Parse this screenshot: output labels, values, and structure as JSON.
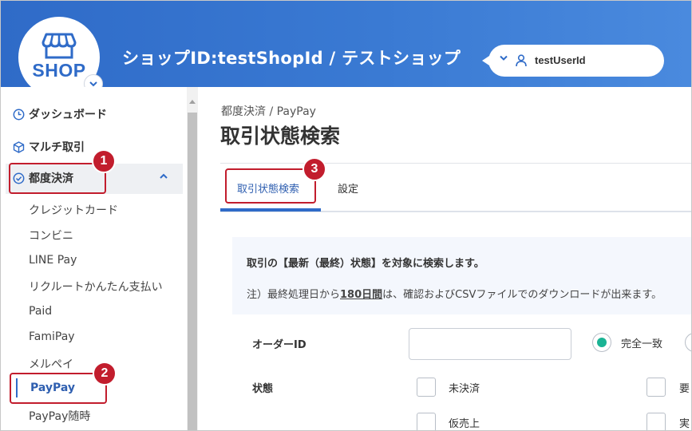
{
  "header": {
    "logo_text": "SHOP",
    "shop_title": "ショップID:testShopId / テストショップ",
    "user_name": "testUserId"
  },
  "sidebar": {
    "items": [
      {
        "label": "ダッシュボード",
        "icon": "clock-icon"
      },
      {
        "label": "マルチ取引",
        "icon": "cube-icon"
      },
      {
        "label": "都度決済",
        "icon": "check-circle-icon",
        "expanded": true
      }
    ],
    "sub_items": [
      {
        "label": "クレジットカード"
      },
      {
        "label": "コンビニ"
      },
      {
        "label": "LINE Pay"
      },
      {
        "label": "リクルートかんたん支払い"
      },
      {
        "label": "Paid"
      },
      {
        "label": "FamiPay"
      },
      {
        "label": "メルペイ"
      },
      {
        "label": "PayPay",
        "active": true
      },
      {
        "label": "PayPay随時"
      }
    ]
  },
  "annotations": [
    "1",
    "2",
    "3"
  ],
  "main": {
    "breadcrumb": "都度決済 / PayPay",
    "page_title": "取引状態検索",
    "tabs": [
      {
        "label": "取引状態検索",
        "active": true
      },
      {
        "label": "設定"
      }
    ],
    "notice": {
      "line1": "取引の【最新（最終）状態】を対象に検索します。",
      "line2_prefix": "注）最終処理日から",
      "line2_em": "180日間",
      "line2_suffix": "は、確認およびCSVファイルでのダウンロードが出来ます。"
    },
    "form": {
      "order_id_label": "オーダーID",
      "order_id_value": "",
      "match_option": "完全一致",
      "status_label": "状態",
      "status_options": [
        "未決済",
        "仮売上",
        "要",
        "実"
      ]
    }
  },
  "colors": {
    "header_blue": "#2f6bc8",
    "accent_red": "#c21d2d",
    "radio_green": "#1ab394",
    "active_link": "#2f5fb0"
  }
}
